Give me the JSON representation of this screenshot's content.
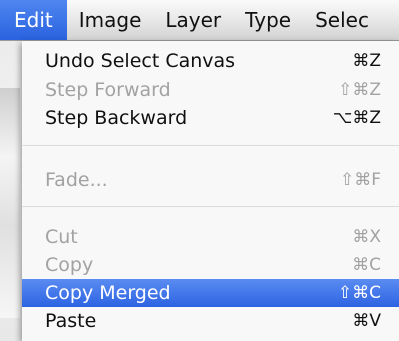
{
  "menubar": {
    "items": [
      {
        "label": "Edit",
        "active": true
      },
      {
        "label": "Image"
      },
      {
        "label": "Layer"
      },
      {
        "label": "Type"
      },
      {
        "label": "Selec"
      }
    ]
  },
  "edit_menu": {
    "items": [
      {
        "label": "Undo Select Canvas",
        "shortcut": "⌘Z",
        "state": "enabled"
      },
      {
        "label": "Step Forward",
        "shortcut": "⇧⌘Z",
        "state": "disabled"
      },
      {
        "label": "Step Backward",
        "shortcut": "⌥⌘Z",
        "state": "enabled"
      },
      {
        "label": "Fade...",
        "shortcut": "⇧⌘F",
        "state": "disabled"
      },
      {
        "label": "Cut",
        "shortcut": "⌘X",
        "state": "disabled"
      },
      {
        "label": "Copy",
        "shortcut": "⌘C",
        "state": "disabled"
      },
      {
        "label": "Copy Merged",
        "shortcut": "⇧⌘C",
        "state": "highlighted"
      },
      {
        "label": "Paste",
        "shortcut": "⌘V",
        "state": "enabled"
      }
    ]
  },
  "colors": {
    "highlight": "#2d63e2",
    "disabled_text": "#a2a2a2"
  }
}
